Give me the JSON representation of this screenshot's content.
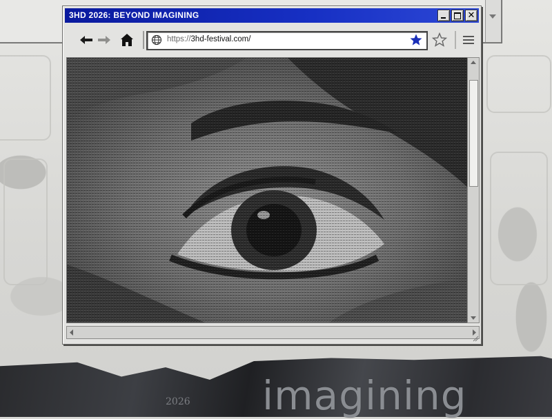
{
  "window": {
    "title": "3HD 2026: BEYOND IMAGINING",
    "controls": [
      "minimize",
      "maximize",
      "close"
    ]
  },
  "toolbar": {
    "back_icon": "arrow-left-icon",
    "forward_icon": "arrow-right-icon",
    "home_icon": "home-icon",
    "menu_icon": "hamburger-menu-icon",
    "bookmark_icon": "star-outline-icon"
  },
  "address_bar": {
    "protocol": "https://",
    "host": "3hd-festival.com/",
    "favorite_active_color": "#1a2fb8"
  },
  "background": {
    "headline": "imagining",
    "small_text": "2026"
  }
}
